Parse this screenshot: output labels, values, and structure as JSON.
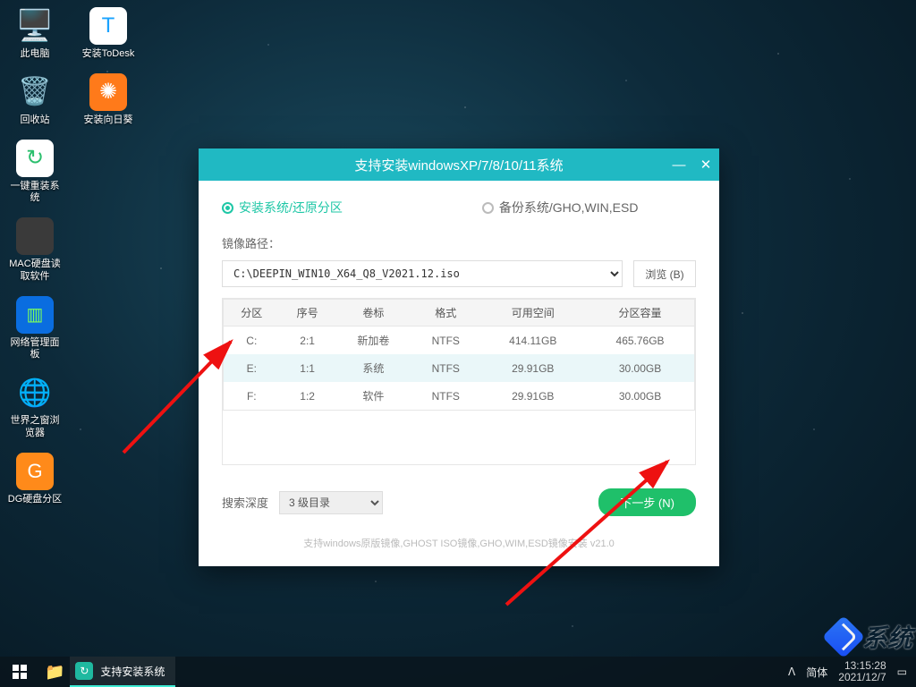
{
  "desktop_icons": {
    "row0": [
      {
        "label": "此电脑",
        "glyph": "🖥️",
        "bg": "transparent",
        "fs": "34px"
      },
      {
        "label": "安装ToDesk",
        "glyph": "T",
        "bg": "#fff",
        "color": "#1aa3ff",
        "fs": "24px"
      }
    ],
    "col": [
      [
        {
          "label": "回收站",
          "glyph": "🗑️",
          "bg": "transparent",
          "fs": "30px"
        },
        {
          "label": "安装向日葵",
          "glyph": "✺",
          "bg": "#ff7a1a",
          "color": "#fff",
          "fs": "24px"
        }
      ],
      [
        {
          "label": "一键重装系统",
          "glyph": "↻",
          "bg": "#fff",
          "color": "#2bbf6d",
          "fs": "24px"
        }
      ],
      [
        {
          "label": "MAC硬盘读取软件",
          "glyph": "",
          "bg": "#3a3a3a",
          "color": "#ddd",
          "fs": "22px"
        }
      ],
      [
        {
          "label": "网络管理面板",
          "glyph": "▥",
          "bg": "#0a6de0",
          "color": "#7cff5c",
          "fs": "20px"
        }
      ],
      [
        {
          "label": "世界之窗浏览器",
          "glyph": "🌐",
          "bg": "transparent",
          "fs": "30px"
        }
      ],
      [
        {
          "label": "DG硬盘分区",
          "glyph": "G",
          "bg": "#ff8a1a",
          "color": "#fff",
          "fs": "22px"
        }
      ]
    ]
  },
  "window": {
    "title": "支持安装windowsXP/7/8/10/11系统",
    "radio_install": "安装系统/还原分区",
    "radio_backup": "备份系统/GHO,WIN,ESD",
    "path_label": "镜像路径：",
    "path_value": "C:\\DEEPIN_WIN10_X64_Q8_V2021.12.iso",
    "browse": "浏览 (B)",
    "columns": [
      "分区",
      "序号",
      "卷标",
      "格式",
      "可用空间",
      "分区容量"
    ],
    "rows": [
      {
        "part": "C:",
        "idx": "2:1",
        "vol": "新加卷",
        "fmt": "NTFS",
        "free": "414.11GB",
        "total": "465.76GB"
      },
      {
        "part": "E:",
        "idx": "1:1",
        "vol": "系统",
        "fmt": "NTFS",
        "free": "29.91GB",
        "total": "30.00GB"
      },
      {
        "part": "F:",
        "idx": "1:2",
        "vol": "软件",
        "fmt": "NTFS",
        "free": "29.91GB",
        "total": "30.00GB"
      }
    ],
    "depth_label": "搜索深度",
    "depth_value": "3 级目录",
    "next": "下一步 (N)",
    "hint": "支持windows原版镜像,GHOST ISO镜像,GHO,WIM,ESD镜像安装 v21.0"
  },
  "taskbar": {
    "active_app": "支持安装系统",
    "ime": "简体",
    "time": "13:15:28",
    "date": "2021/12/7"
  },
  "watermark": "系统"
}
